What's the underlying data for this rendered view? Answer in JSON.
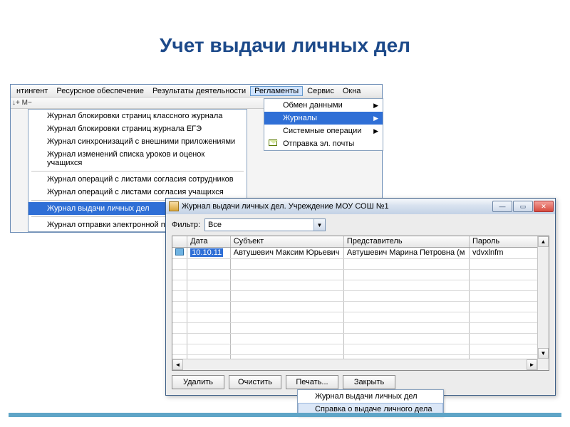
{
  "slide_title": "Учет выдачи личных дел",
  "menubar": {
    "items": [
      "нтингент",
      "Ресурсное обеспечение",
      "Результаты деятельности",
      "Регламенты",
      "Сервис",
      "Окна"
    ],
    "active_index": 3
  },
  "toolbar_hint": "↓+  M−",
  "submenu_reglamenty": {
    "items": [
      {
        "label": "Обмен данными",
        "has_children": true
      },
      {
        "label": "Журналы",
        "has_children": true,
        "highlight": true
      },
      {
        "label": "Системные операции",
        "has_children": true
      },
      {
        "label": "Отправка эл. почты",
        "icon": "mail-icon"
      }
    ]
  },
  "submenu_journals": {
    "groups": [
      [
        "Журнал блокировки страниц классного журнала",
        "Журнал блокировки страниц журнала ЕГЭ",
        "Журнал синхронизаций с внешними приложениями",
        "Журнал изменений списка уроков и оценок учащихся"
      ],
      [
        "Журнал операций с листами согласия сотрудников",
        "Журнал операций с листами согласия учащихся"
      ],
      [
        "Журнал выдачи личных дел"
      ],
      [
        "Журнал отправки электронной почты"
      ]
    ],
    "selected": "Журнал выдачи личных дел"
  },
  "window2": {
    "title": "Журнал выдачи личных дел. Учреждение МОУ СОШ №1",
    "filter_label": "Фильтр:",
    "filter_value": "Все",
    "columns": [
      "",
      "Дата",
      "Субъект",
      "Представитель",
      "Пароль"
    ],
    "rows": [
      {
        "date": "10.10.11",
        "subject": "Автушевич Максим Юрьевич",
        "rep": "Автушевич Марина Петровна (м",
        "pass": "vdvxlnfm"
      }
    ],
    "empty_rows": 10,
    "buttons": [
      "Удалить",
      "Очистить",
      "Печать...",
      "Закрыть"
    ],
    "print_menu": [
      "Журнал выдачи личных дел",
      "Справка о выдаче личного дела"
    ],
    "print_menu_highlight_index": 1
  }
}
